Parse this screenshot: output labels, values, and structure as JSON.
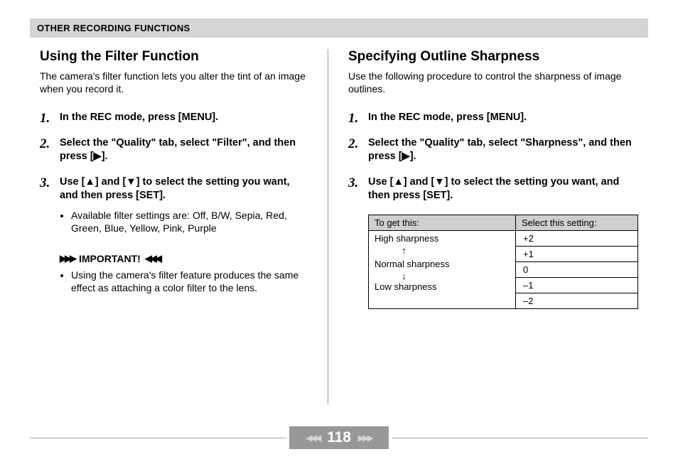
{
  "header": "OTHER RECORDING FUNCTIONS",
  "page_number": "118",
  "left": {
    "title": "Using the Filter Function",
    "intro": "The camera's filter function lets you alter the tint of an image when you record it.",
    "steps": [
      "In the REC mode, press [MENU].",
      "Select the \"Quality\" tab, select \"Filter\", and then press [▶].",
      "Use [▲] and [▼] to select the setting you want, and then press [SET]."
    ],
    "sub_bullet": "Available filter settings are: Off, B/W, Sepia, Red, Green, Blue, Yellow, Pink, Purple",
    "important_label": "IMPORTANT!",
    "important_bullet": "Using the camera's filter feature produces the same effect as attaching a color filter to the lens."
  },
  "right": {
    "title": "Specifying Outline Sharpness",
    "intro": "Use the following procedure to control the sharpness of image outlines.",
    "steps": [
      "In the REC mode, press [MENU].",
      "Select the \"Quality\" tab, select \"Sharpness\", and then press [▶].",
      "Use [▲] and [▼] to select the setting you want, and then press [SET]."
    ],
    "table": {
      "head_left": "To get this:",
      "head_right": "Select this setting:",
      "high": "High sharpness",
      "normal": "Normal sharpness",
      "low": "Low sharpness",
      "vals": [
        "+2",
        "+1",
        " 0",
        "–1",
        "–2"
      ]
    }
  }
}
